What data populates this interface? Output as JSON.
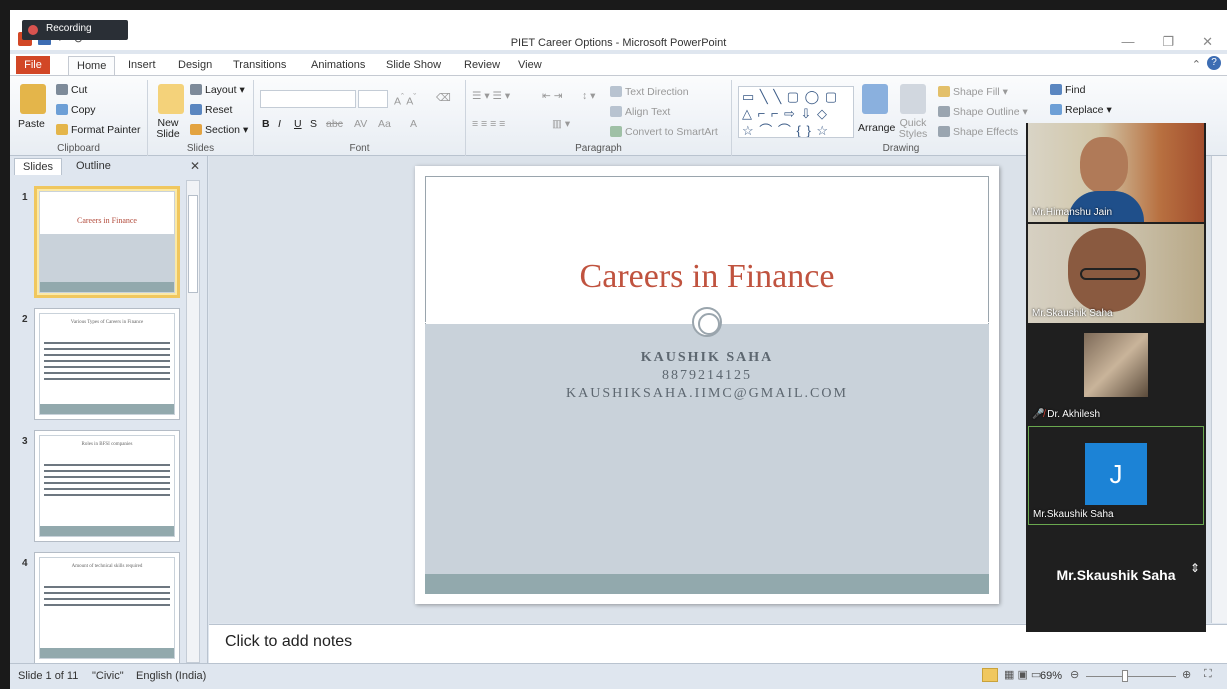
{
  "recording": {
    "label": "Recording"
  },
  "window": {
    "title": "PIET Career Options - Microsoft PowerPoint"
  },
  "tabs": [
    {
      "label": "File"
    },
    {
      "label": "Home"
    },
    {
      "label": "Insert"
    },
    {
      "label": "Design"
    },
    {
      "label": "Transitions"
    },
    {
      "label": "Animations"
    },
    {
      "label": "Slide Show"
    },
    {
      "label": "Review"
    },
    {
      "label": "View"
    }
  ],
  "ribbon": {
    "clipboard": {
      "label": "Clipboard",
      "paste": "Paste",
      "cut": "Cut",
      "copy": "Copy",
      "format_painter": "Format Painter"
    },
    "slides": {
      "label": "Slides",
      "new_slide": "New Slide",
      "layout": "Layout",
      "reset": "Reset",
      "section": "Section"
    },
    "font": {
      "label": "Font"
    },
    "paragraph": {
      "label": "Paragraph",
      "text_direction": "Text Direction",
      "align_text": "Align Text",
      "convert": "Convert to SmartArt"
    },
    "drawing": {
      "label": "Drawing",
      "arrange": "Arrange",
      "quick_styles": "Quick Styles",
      "shape_fill": "Shape Fill",
      "shape_outline": "Shape Outline",
      "shape_effects": "Shape Effects"
    },
    "editing": {
      "find": "Find",
      "replace": "Replace"
    }
  },
  "panel": {
    "tabs": [
      {
        "label": "Slides"
      },
      {
        "label": "Outline"
      }
    ],
    "thumbnails": [
      {
        "num": "1",
        "title": "Careers in Finance"
      },
      {
        "num": "2",
        "title": "Various Types of Careers in Finance"
      },
      {
        "num": "3",
        "title": "Roles in BFSI companies"
      },
      {
        "num": "4",
        "title": "Amount of technical skills required"
      }
    ]
  },
  "slide": {
    "title": "Careers in Finance",
    "name": "KAUSHIK SAHA",
    "phone": "8879214125",
    "email": "KAUSHIKSAHA.IIMC@GMAIL.COM"
  },
  "notes": {
    "placeholder": "Click to add notes"
  },
  "status": {
    "slide": "Slide 1 of 11",
    "theme": "\"Civic\"",
    "language": "English (India)",
    "zoom": "69%"
  },
  "participants": [
    {
      "name": "Mr.Himanshu Jain"
    },
    {
      "name": "Mr.Skaushik Saha"
    },
    {
      "name": "Dr. Akhilesh"
    },
    {
      "name": "Mr.Skaushik Saha",
      "initial": "J"
    },
    {
      "name": "Mr.Skaushik Saha"
    }
  ],
  "colors": {
    "accent": "#d24726",
    "slide_title": "#c0533f",
    "band": "#c9d2da",
    "footer": "#92a9ad"
  }
}
